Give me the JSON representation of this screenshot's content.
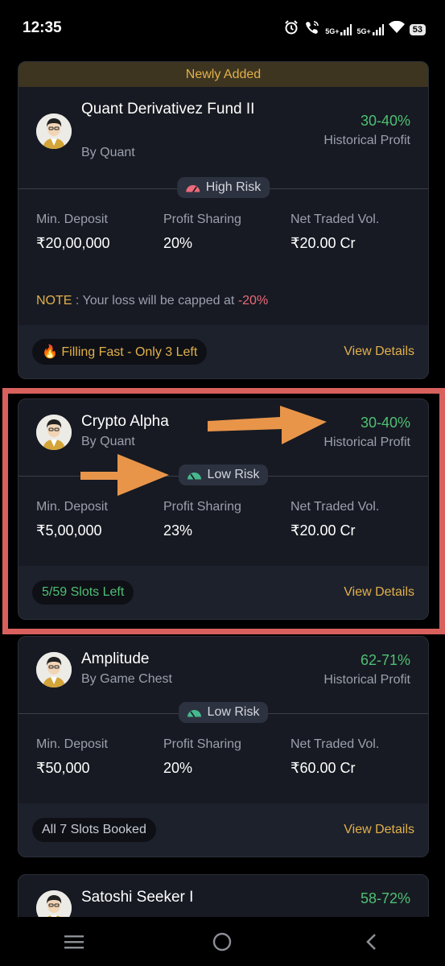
{
  "status_bar": {
    "time": "12:35",
    "signal1": "5G+",
    "signal2": "5G+",
    "battery": "53"
  },
  "cards": [
    {
      "banner": "Newly Added",
      "name": "Quant Derivativez Fund II",
      "by": "By Quant",
      "profit": "30-40%",
      "profit_label": "Historical Profit",
      "risk": "High Risk",
      "risk_color": "#ec6a7b",
      "min_deposit_label": "Min. Deposit",
      "min_deposit": "₹20,00,000",
      "profit_sharing_label": "Profit Sharing",
      "profit_sharing": "20%",
      "net_traded_label": "Net Traded Vol.",
      "net_traded": "₹20.00 Cr",
      "note_key": "NOTE",
      "note_text": " : Your loss will be capped at ",
      "note_value": "-20%",
      "tag_icon": "🔥",
      "tag": "Filling Fast - Only 3 Left",
      "tag_color": "#e2b04a",
      "view": "View Details"
    },
    {
      "name": "Crypto Alpha",
      "by": "By Quant",
      "profit": "30-40%",
      "profit_label": "Historical Profit",
      "risk": "Low Risk",
      "risk_color": "#46b88d",
      "min_deposit_label": "Min. Deposit",
      "min_deposit": "₹5,00,000",
      "profit_sharing_label": "Profit Sharing",
      "profit_sharing": "23%",
      "net_traded_label": "Net Traded Vol.",
      "net_traded": "₹20.00 Cr",
      "tag": "5/59 Slots Left",
      "tag_color": "#4fbf74",
      "view": "View Details"
    },
    {
      "name": "Amplitude",
      "by": "By Game Chest",
      "profit": "62-71%",
      "profit_label": "Historical Profit",
      "risk": "Low Risk",
      "risk_color": "#46b88d",
      "min_deposit_label": "Min. Deposit",
      "min_deposit": "₹50,000",
      "profit_sharing_label": "Profit Sharing",
      "profit_sharing": "20%",
      "net_traded_label": "Net Traded Vol.",
      "net_traded": "₹60.00 Cr",
      "tag": "All 7 Slots Booked",
      "tag_color": "#c7cbd3",
      "view": "View Details"
    },
    {
      "name": "Satoshi Seeker I",
      "profit": "58-72%"
    }
  ],
  "colors": {
    "accent": "#e2b04a",
    "profit_green": "#4fbf74",
    "highlight": "#d8615e",
    "arrow": "#e8954a"
  }
}
